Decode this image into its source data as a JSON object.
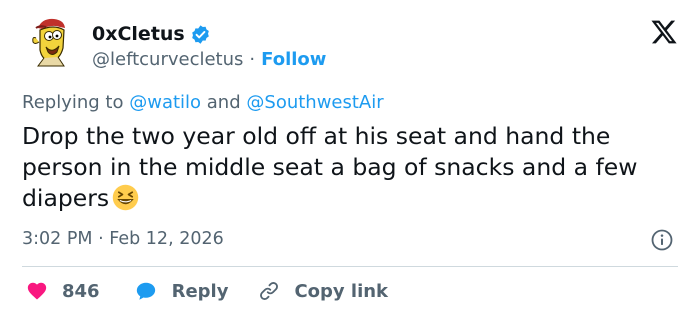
{
  "author": {
    "display_name": "0xCletus",
    "handle": "@leftcurvecletus",
    "separator": "·",
    "follow_label": "Follow",
    "avatar_icon": "cartoon-avatar-icon",
    "verified_icon": "verified-badge-icon"
  },
  "platform_logo": "x-logo-icon",
  "reply_context": {
    "prefix": "Replying to",
    "mention_1": "@watilo",
    "conjunction": "and",
    "mention_2": "@SouthwestAir"
  },
  "tweet_text": "Drop the two year old off at his seat and hand the person in the middle seat a bag of snacks and a few diapers",
  "emoji": "laughing-face-emoji",
  "timestamp": {
    "time": "3:02 PM",
    "separator": "·",
    "date": "Feb 12, 2026"
  },
  "actions": {
    "like_count": "846",
    "reply_label": "Reply",
    "copy_label": "Copy link"
  },
  "colors": {
    "accent": "#1d9bf0",
    "like": "#f91880",
    "text": "#0f1419",
    "muted": "#536471",
    "divider": "#cfd9de"
  }
}
